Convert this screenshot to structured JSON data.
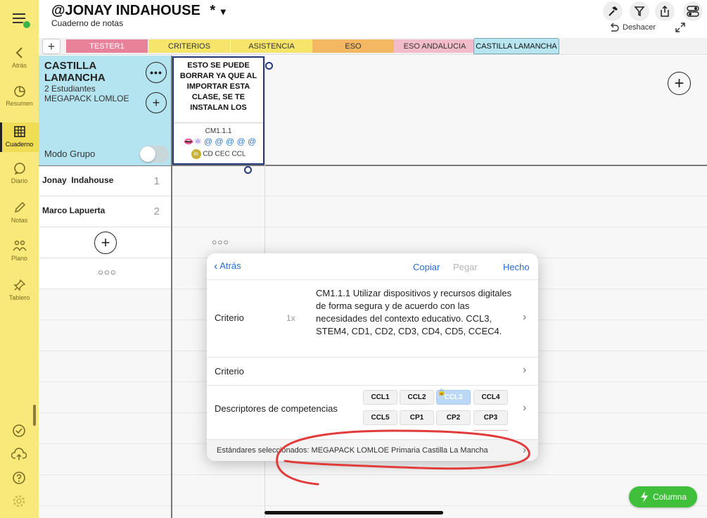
{
  "sidebar": {
    "items": [
      {
        "label": "Atrás",
        "icon": "chevron-left-icon"
      },
      {
        "label": "Resumen",
        "icon": "pie-chart-icon"
      },
      {
        "label": "Cuaderno",
        "icon": "grid-icon"
      },
      {
        "label": "Diario",
        "icon": "chat-bubble-icon"
      },
      {
        "label": "Notas",
        "icon": "pencil-icon"
      },
      {
        "label": "Plano",
        "icon": "people-icon"
      },
      {
        "label": "Tablero",
        "icon": "pin-icon"
      }
    ]
  },
  "header": {
    "title": "@JONAY INDAHOUSE",
    "unsaved_mark": "*",
    "dropdown": "▾",
    "subtitle": "Cuaderno de notas",
    "undo_label": "Deshacer"
  },
  "tabs": [
    {
      "label": "TESTER1",
      "color": "#e8819a",
      "text": "#ffffff"
    },
    {
      "label": "CRITERIOS",
      "color": "#f7e46a",
      "text": "#333333"
    },
    {
      "label": "ASISTENCIA",
      "color": "#f7e46a",
      "text": "#333333"
    },
    {
      "label": "ESO",
      "color": "#f5b862",
      "text": "#333333"
    },
    {
      "label": "ESO ANDALUCIA",
      "color": "#f3bccb",
      "text": "#333333"
    },
    {
      "label": "CASTILLA LAMANCHA",
      "color": "#b8e6f0",
      "text": "#111111"
    }
  ],
  "class_panel": {
    "title_line1": "CASTILLA",
    "title_line2": "LAMANCHA",
    "students": "2 Estudiantes",
    "pack": "MEGAPACK LOMLOE",
    "group_mode": "Modo Grupo"
  },
  "column": {
    "title": "ESTO SE PUEDE BORRAR YA QUE AL IMPORTAR ESTA CLASE, SE TE INSTALAN LOS",
    "code": "CM1.1.1",
    "competences": "CD CEC CCL"
  },
  "students": [
    {
      "name": "Jonay  Indahouse",
      "number": "1"
    },
    {
      "name": "Marco Lapuerta",
      "number": "2"
    }
  ],
  "popover": {
    "back": "Atrás",
    "copy": "Copiar",
    "paste": "Pegar",
    "done": "Hecho",
    "criterio_label": "Criterio",
    "multiplier": "1x",
    "criterio_text": "CM1.1.1 Utilizar dispositivos y recursos digitales de forma segura y de acuerdo con las necesidades del contexto educativo. CCL3, STEM4, CD1, CD2, CD3, CD4, CD5, CCEC4.",
    "criterio2_label": "Criterio",
    "descriptors_label": "Descriptores de competencias",
    "chips": [
      "CCL1",
      "CCL2",
      "CCL3",
      "CCL4",
      "CCL5",
      "CP1",
      "CP2",
      "CP3"
    ],
    "footer": "Estándares seleccionados: MEGAPACK LOMLOE Primaria Castilla La Mancha"
  },
  "fab": {
    "label": "Columna"
  }
}
